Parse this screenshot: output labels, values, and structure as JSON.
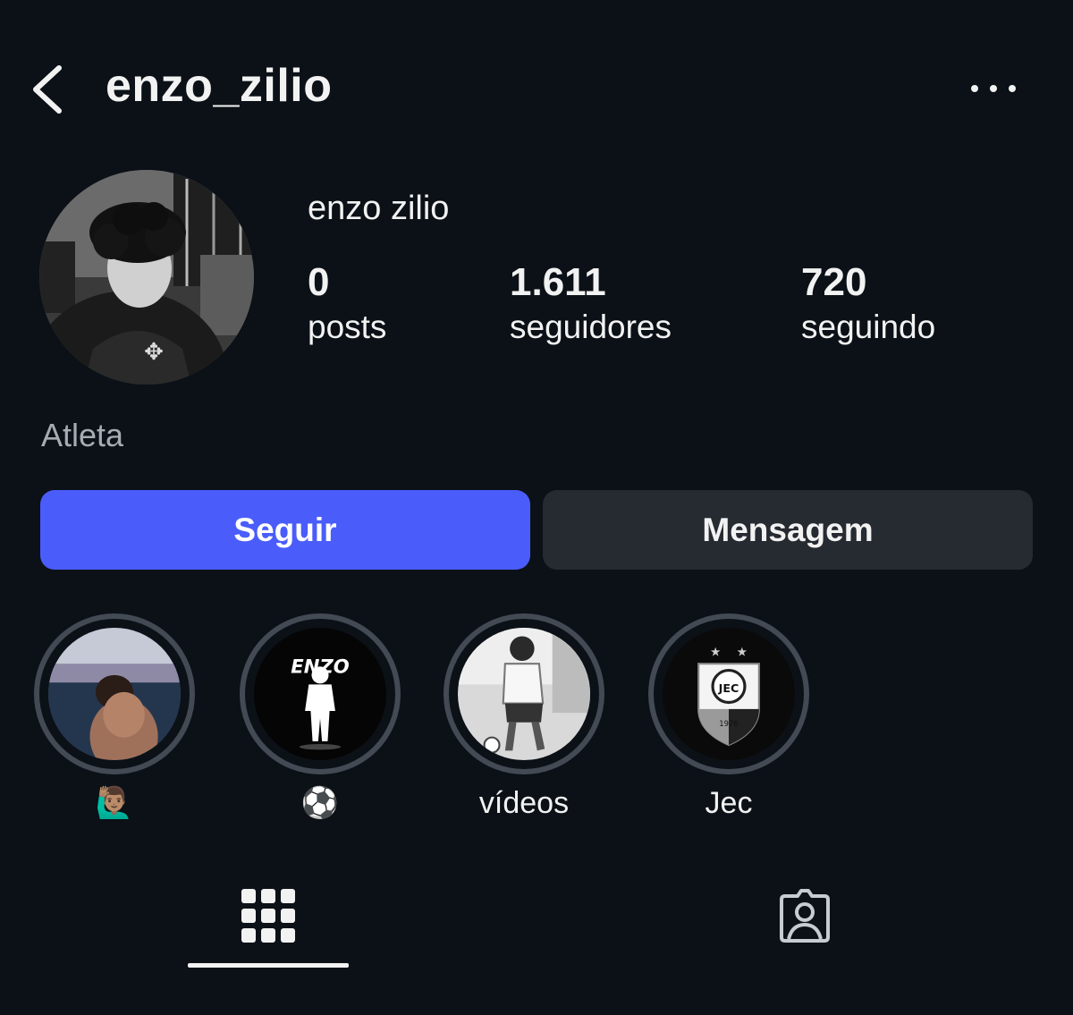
{
  "header": {
    "username": "enzo_zilio",
    "back_icon": "chevron-left-icon",
    "more_icon": "more-horizontal-icon"
  },
  "profile": {
    "display_name": "enzo zilio",
    "category": "Atleta",
    "stats": {
      "posts_count": "0",
      "posts_label": "posts",
      "followers_count": "1.611",
      "followers_label": "seguidores",
      "following_count": "720",
      "following_label": "seguindo"
    }
  },
  "actions": {
    "follow_label": "Seguir",
    "message_label": "Mensagem",
    "follow_color": "#4a5dfb",
    "message_color": "#262a31"
  },
  "highlights": [
    {
      "label": "🙋🏽‍♂️"
    },
    {
      "label": "⚽"
    },
    {
      "label": "vídeos"
    },
    {
      "label": "Jec"
    }
  ],
  "highlight_thumb_texts": {
    "enzo_logo_text": "ENZO",
    "jec_badge_text": "JEC",
    "jec_year": "1976"
  },
  "tabs": [
    {
      "icon": "grid-icon",
      "active": true
    },
    {
      "icon": "tagged-person-icon",
      "active": false
    }
  ],
  "colors": {
    "background": "#0b1117",
    "text": "#f2f2f2",
    "muted_text": "#a7acb2",
    "highlight_ring": "#434a54"
  }
}
